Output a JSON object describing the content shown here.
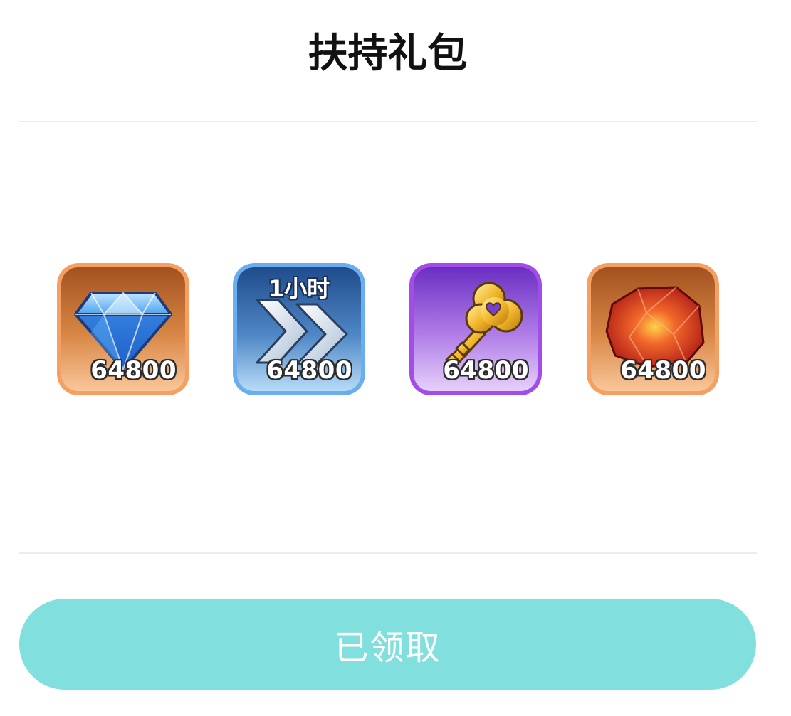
{
  "header": {
    "title": "扶持礼包"
  },
  "rewards": [
    {
      "name": "diamond-icon",
      "quantity": "64800",
      "tag": ""
    },
    {
      "name": "speedup-icon",
      "quantity": "64800",
      "tag": "1小时"
    },
    {
      "name": "key-icon",
      "quantity": "64800",
      "tag": ""
    },
    {
      "name": "red-crystal-icon",
      "quantity": "64800",
      "tag": ""
    }
  ],
  "footer": {
    "claim_label": "已领取"
  },
  "colors": {
    "claim_button": "#81dfdd",
    "orange_frame": "#f5a062",
    "blue_frame": "#6aaef0",
    "purple_frame": "#a24de8"
  }
}
